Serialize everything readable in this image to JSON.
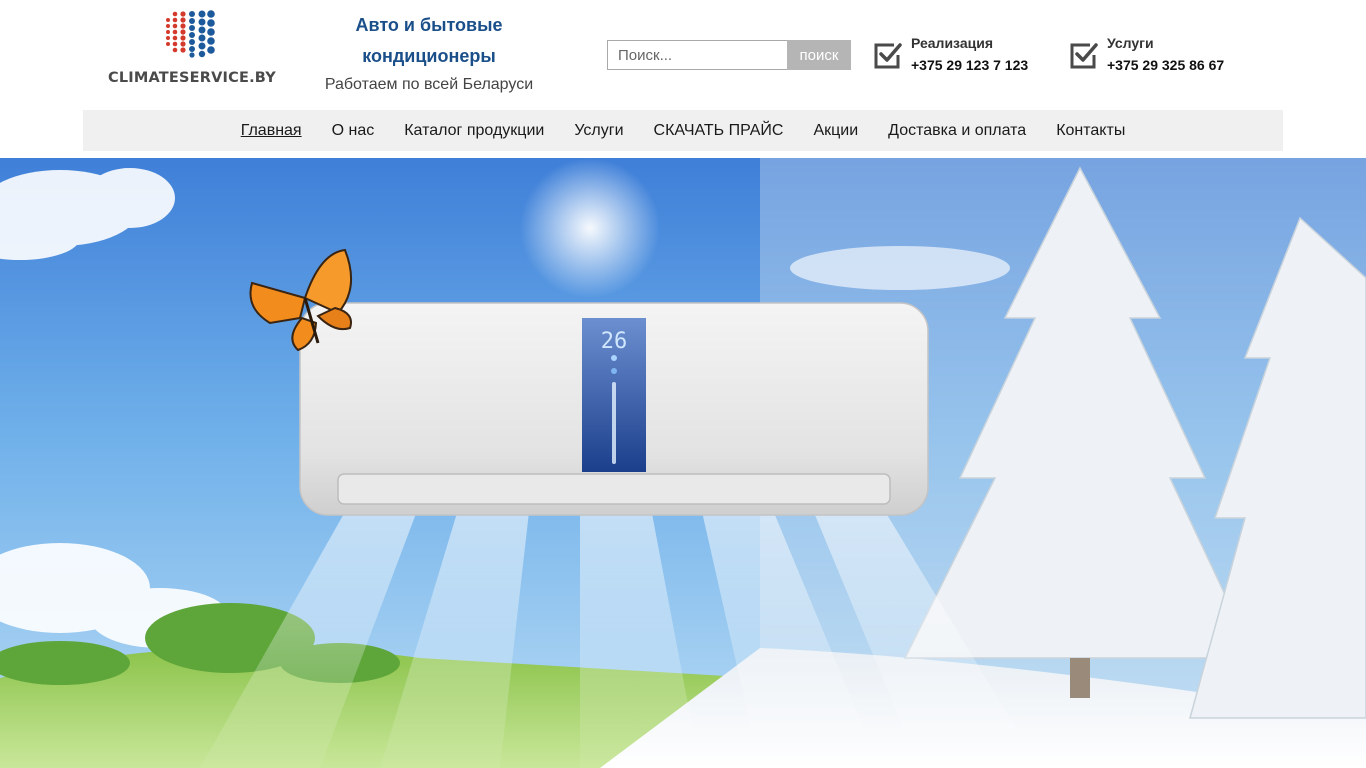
{
  "brand": {
    "logo_text": "CLIMATESERVICE.BY",
    "dot_color_red": "#d33a2c",
    "dot_color_blue": "#1d5a9c"
  },
  "tagline": {
    "title": "Авто и бытовые кондиционеры",
    "subtitle": "Работаем по всей Беларуси"
  },
  "search": {
    "placeholder": "Поиск...",
    "button_label": "поиск"
  },
  "contacts": [
    {
      "label": "Реализация",
      "phone": "+375 29 123 7 123",
      "icon": "check-icon"
    },
    {
      "label": "Услуги",
      "phone": "+375 29 325 86 67",
      "icon": "check-icon"
    }
  ],
  "nav": {
    "items": [
      {
        "label": "Главная",
        "active": true
      },
      {
        "label": "О нас"
      },
      {
        "label": "Каталог продукции"
      },
      {
        "label": "Услуги"
      },
      {
        "label": "СКАЧАТЬ ПРАЙС"
      },
      {
        "label": "Акции"
      },
      {
        "label": "Доставка и оплата"
      },
      {
        "label": "Контакты"
      }
    ]
  },
  "hero": {
    "display_temperature": "26"
  },
  "colors": {
    "tagline_blue": "#1a4f8a",
    "nav_background": "#f0f0f0",
    "search_button": "#b5b5b5"
  }
}
